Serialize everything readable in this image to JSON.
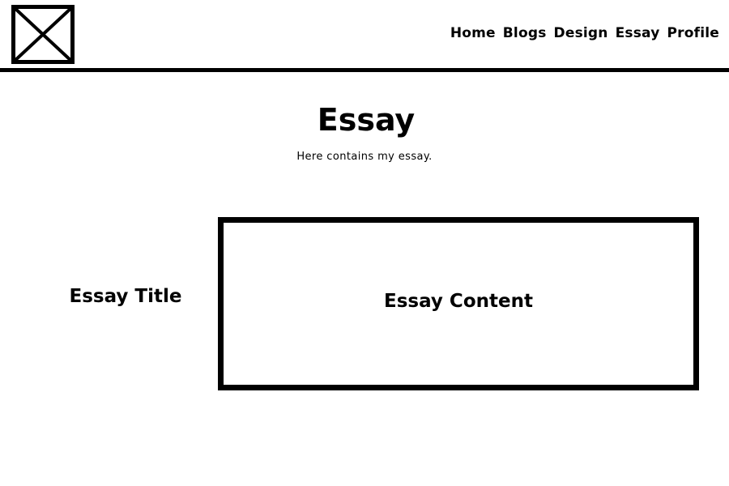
{
  "logo": {
    "icon": "image-placeholder-icon"
  },
  "nav": {
    "items": [
      {
        "label": "Home"
      },
      {
        "label": "Blogs"
      },
      {
        "label": "Design"
      },
      {
        "label": "Essay"
      },
      {
        "label": "Profile"
      }
    ]
  },
  "hero": {
    "title": "Essay",
    "subtitle": "Here contains my essay."
  },
  "essay": {
    "title": "Essay Title",
    "content": "Essay Content"
  },
  "colors": {
    "foreground": "#000000",
    "background": "#ffffff"
  }
}
